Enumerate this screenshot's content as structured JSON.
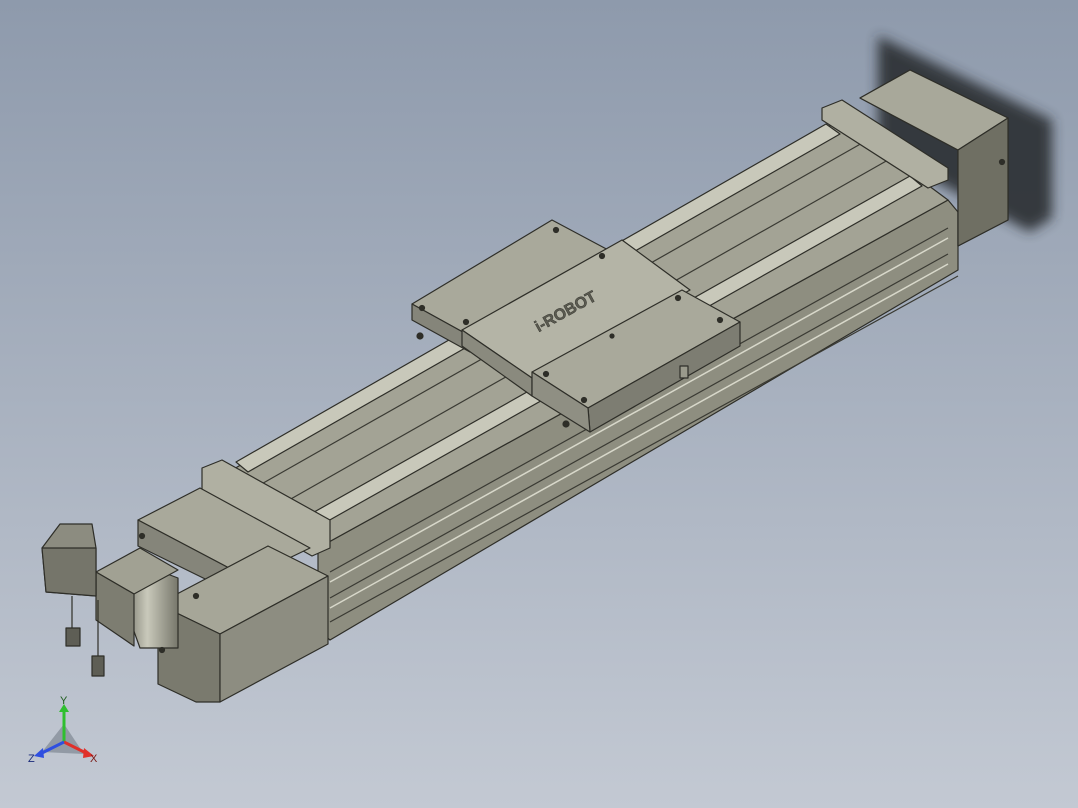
{
  "viewport": {
    "background_top": "#8e9aac",
    "background_bottom": "#c3c9d3"
  },
  "model": {
    "brand_logo": "i-ROBOT",
    "body_color": "#9a9a8c",
    "dark_color": "#6e6e62",
    "light_color": "#bcbcae",
    "edge_color": "#2e2e28"
  },
  "triad": {
    "x_label": "X",
    "y_label": "Y",
    "z_label": "Z",
    "x_color": "#e0302a",
    "y_color": "#2fbf2f",
    "z_color": "#2f4fe0"
  }
}
